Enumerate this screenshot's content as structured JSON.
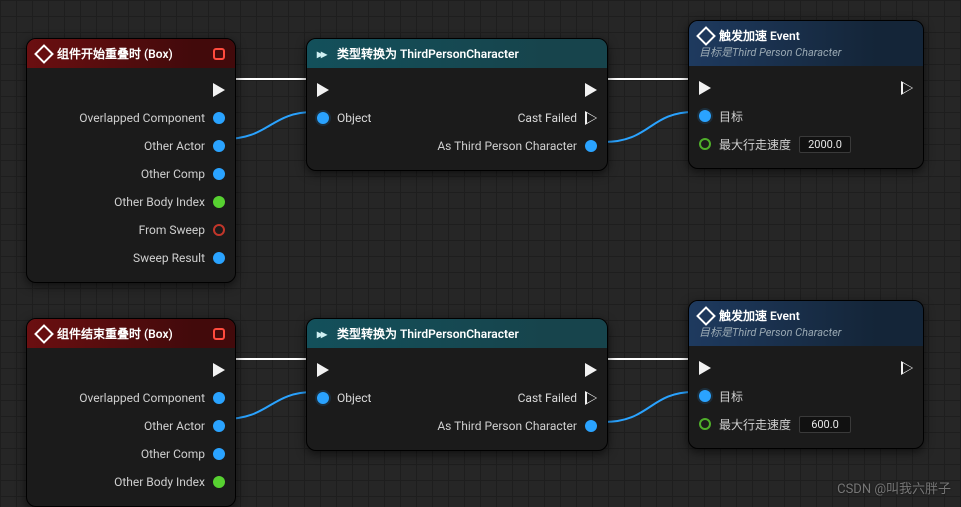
{
  "nodes": {
    "eventBeginOverlap": {
      "title": "组件开始重叠时 (Box)",
      "pins": {
        "overlappedComponent": "Overlapped Component",
        "otherActor": "Other Actor",
        "otherComp": "Other Comp",
        "otherBodyIndex": "Other Body Index",
        "fromSweep": "From Sweep",
        "sweepResult": "Sweep Result"
      }
    },
    "castNode1": {
      "title": "类型转换为 ThirdPersonCharacter",
      "pins": {
        "object": "Object",
        "castFailed": "Cast Failed",
        "asCharacter": "As Third Person Character"
      }
    },
    "speedEvent1": {
      "title": "触发加速 Event",
      "subtitle": "目标是Third Person Character",
      "pins": {
        "target": "目标",
        "maxWalkSpeedLabel": "最大行走速度",
        "maxWalkSpeedValue": "2000.0"
      }
    },
    "eventEndOverlap": {
      "title": "组件结束重叠时 (Box)",
      "pins": {
        "overlappedComponent": "Overlapped Component",
        "otherActor": "Other Actor",
        "otherComp": "Other Comp",
        "otherBodyIndex": "Other Body Index"
      }
    },
    "castNode2": {
      "title": "类型转换为 ThirdPersonCharacter",
      "pins": {
        "object": "Object",
        "castFailed": "Cast Failed",
        "asCharacter": "As Third Person Character"
      }
    },
    "speedEvent2": {
      "title": "触发加速 Event",
      "subtitle": "目标是Third Person Character",
      "pins": {
        "target": "目标",
        "maxWalkSpeedLabel": "最大行走速度",
        "maxWalkSpeedValue": "600.0"
      }
    }
  },
  "watermark": "CSDN @叫我六胖子"
}
